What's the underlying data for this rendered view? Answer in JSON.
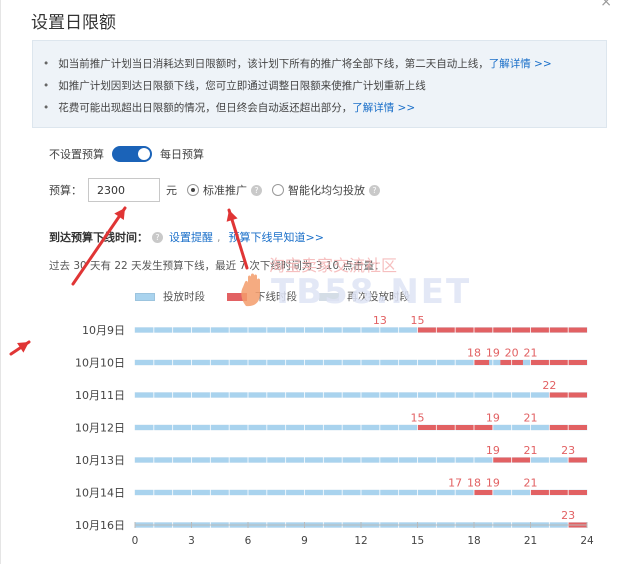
{
  "dialog": {
    "title": "设置日限额",
    "close_label": "×"
  },
  "notice": {
    "items": [
      {
        "text": "如当前推广计划当日消耗达到日限额时，该计划下所有的推广将全部下线，第二天自动上线，",
        "link": "了解详情 >>"
      },
      {
        "text": "如推广计划因到达日限额下线，您可立即通过调整日限额来使推广计划重新上线",
        "link": ""
      },
      {
        "text": "花费可能出现超出日限额的情况，但日终会自动返还超出部分，",
        "link": "了解详情 >>"
      }
    ]
  },
  "budget_toggle": {
    "left_label": "不设置预算",
    "right_label": "每日预算",
    "state": "on"
  },
  "budget": {
    "label": "预算：",
    "value": "2300",
    "unit": "元",
    "options": [
      {
        "label": "标准推广",
        "selected": true
      },
      {
        "label": "智能化均匀投放",
        "selected": false
      }
    ]
  },
  "offline_time": {
    "label": "到达预算下线时间：",
    "remind_link": "设置提醒",
    "learn_link": "预算下线早知道>>"
  },
  "summary": {
    "text": "过去 30 天有 22 天发生预算下线，最近 7 次下线时间为 3.10 点击量："
  },
  "watermark": {
    "line1": "淘宝卖家交流社区",
    "line2": "TB58.NET"
  },
  "colors": {
    "on": "#a9d3ee",
    "off": "#e26163",
    "replay": "#d4dde6",
    "accent": "#1b63b8",
    "link": "#1a6fc9",
    "arrow": "#e03535"
  },
  "chart_data": {
    "type": "timeline",
    "legend": [
      {
        "name": "投放时段",
        "color_key": "on"
      },
      {
        "name": "下线时段",
        "color_key": "off"
      },
      {
        "name": "再次投放时段",
        "color_key": "replay"
      }
    ],
    "x_ticks": [
      0,
      3,
      6,
      9,
      12,
      15,
      18,
      21,
      24
    ],
    "xlim": [
      0,
      24
    ],
    "rows": [
      {
        "date": "10月9日",
        "on": [
          [
            0,
            15
          ]
        ],
        "off": [
          [
            15,
            24
          ]
        ],
        "labels": [
          13,
          15
        ]
      },
      {
        "date": "10月10日",
        "on": [
          [
            0,
            18
          ],
          [
            18.8,
            19.4
          ],
          [
            20.6,
            21
          ]
        ],
        "off": [
          [
            18,
            18.8
          ],
          [
            19.4,
            20.6
          ],
          [
            21,
            24
          ]
        ],
        "labels": [
          18,
          19,
          20,
          21
        ]
      },
      {
        "date": "10月11日",
        "on": [
          [
            0,
            22
          ]
        ],
        "off": [
          [
            22,
            24
          ]
        ],
        "labels": [
          22
        ]
      },
      {
        "date": "10月12日",
        "on": [
          [
            0,
            15
          ],
          [
            19,
            22
          ]
        ],
        "off": [
          [
            15,
            19
          ],
          [
            22,
            24
          ]
        ],
        "labels": [
          15,
          19,
          21
        ]
      },
      {
        "date": "10月13日",
        "on": [
          [
            0,
            19
          ],
          [
            21,
            23
          ]
        ],
        "off": [
          [
            19,
            21
          ],
          [
            23,
            24
          ]
        ],
        "labels": [
          19,
          21,
          23
        ]
      },
      {
        "date": "10月14日",
        "on": [
          [
            0,
            17
          ],
          [
            17,
            18
          ],
          [
            19,
            21
          ]
        ],
        "off": [
          [
            18,
            19
          ],
          [
            21,
            24
          ]
        ],
        "labels": [
          17,
          18,
          19,
          21
        ]
      },
      {
        "date": "10月16日",
        "on": [
          [
            0,
            23
          ]
        ],
        "off": [
          [
            23,
            24
          ]
        ],
        "labels": [
          23
        ]
      }
    ]
  }
}
